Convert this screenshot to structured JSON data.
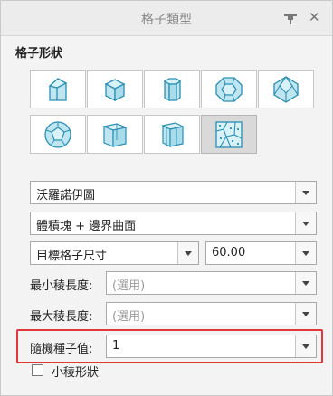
{
  "panel": {
    "title": "格子類型"
  },
  "section": {
    "label": "格子形狀"
  },
  "shapes": [
    {
      "name": "shape-pentagonal-prism"
    },
    {
      "name": "shape-cube"
    },
    {
      "name": "shape-hexagonal-prism"
    },
    {
      "name": "shape-truncated-octahedron"
    },
    {
      "name": "shape-rhombic-dodecahedron"
    },
    {
      "name": "shape-dodecahedron"
    },
    {
      "name": "shape-twisted-prism-a"
    },
    {
      "name": "shape-twisted-prism-b"
    },
    {
      "name": "shape-voronoi"
    }
  ],
  "selected_shape": "shape-voronoi",
  "lattice_type": {
    "value": "沃羅諾伊圖"
  },
  "volume_boundary": {
    "value": "體積塊 + 邊界曲面"
  },
  "target_size": {
    "mode": "目標格子尺寸",
    "value": "60.00"
  },
  "min_edge": {
    "label": "最小稜長度:",
    "placeholder": "(選用)"
  },
  "max_edge": {
    "label": "最大稜長度:",
    "placeholder": "(選用)"
  },
  "random_seed": {
    "label": "隨機種子值:",
    "value": "1"
  },
  "small_edge": {
    "label": "小稜形狀",
    "checked": false
  },
  "colors": {
    "highlight": "#e0373b",
    "shape_fill": "#bfe6f0",
    "shape_stroke": "#2a8fb2"
  }
}
